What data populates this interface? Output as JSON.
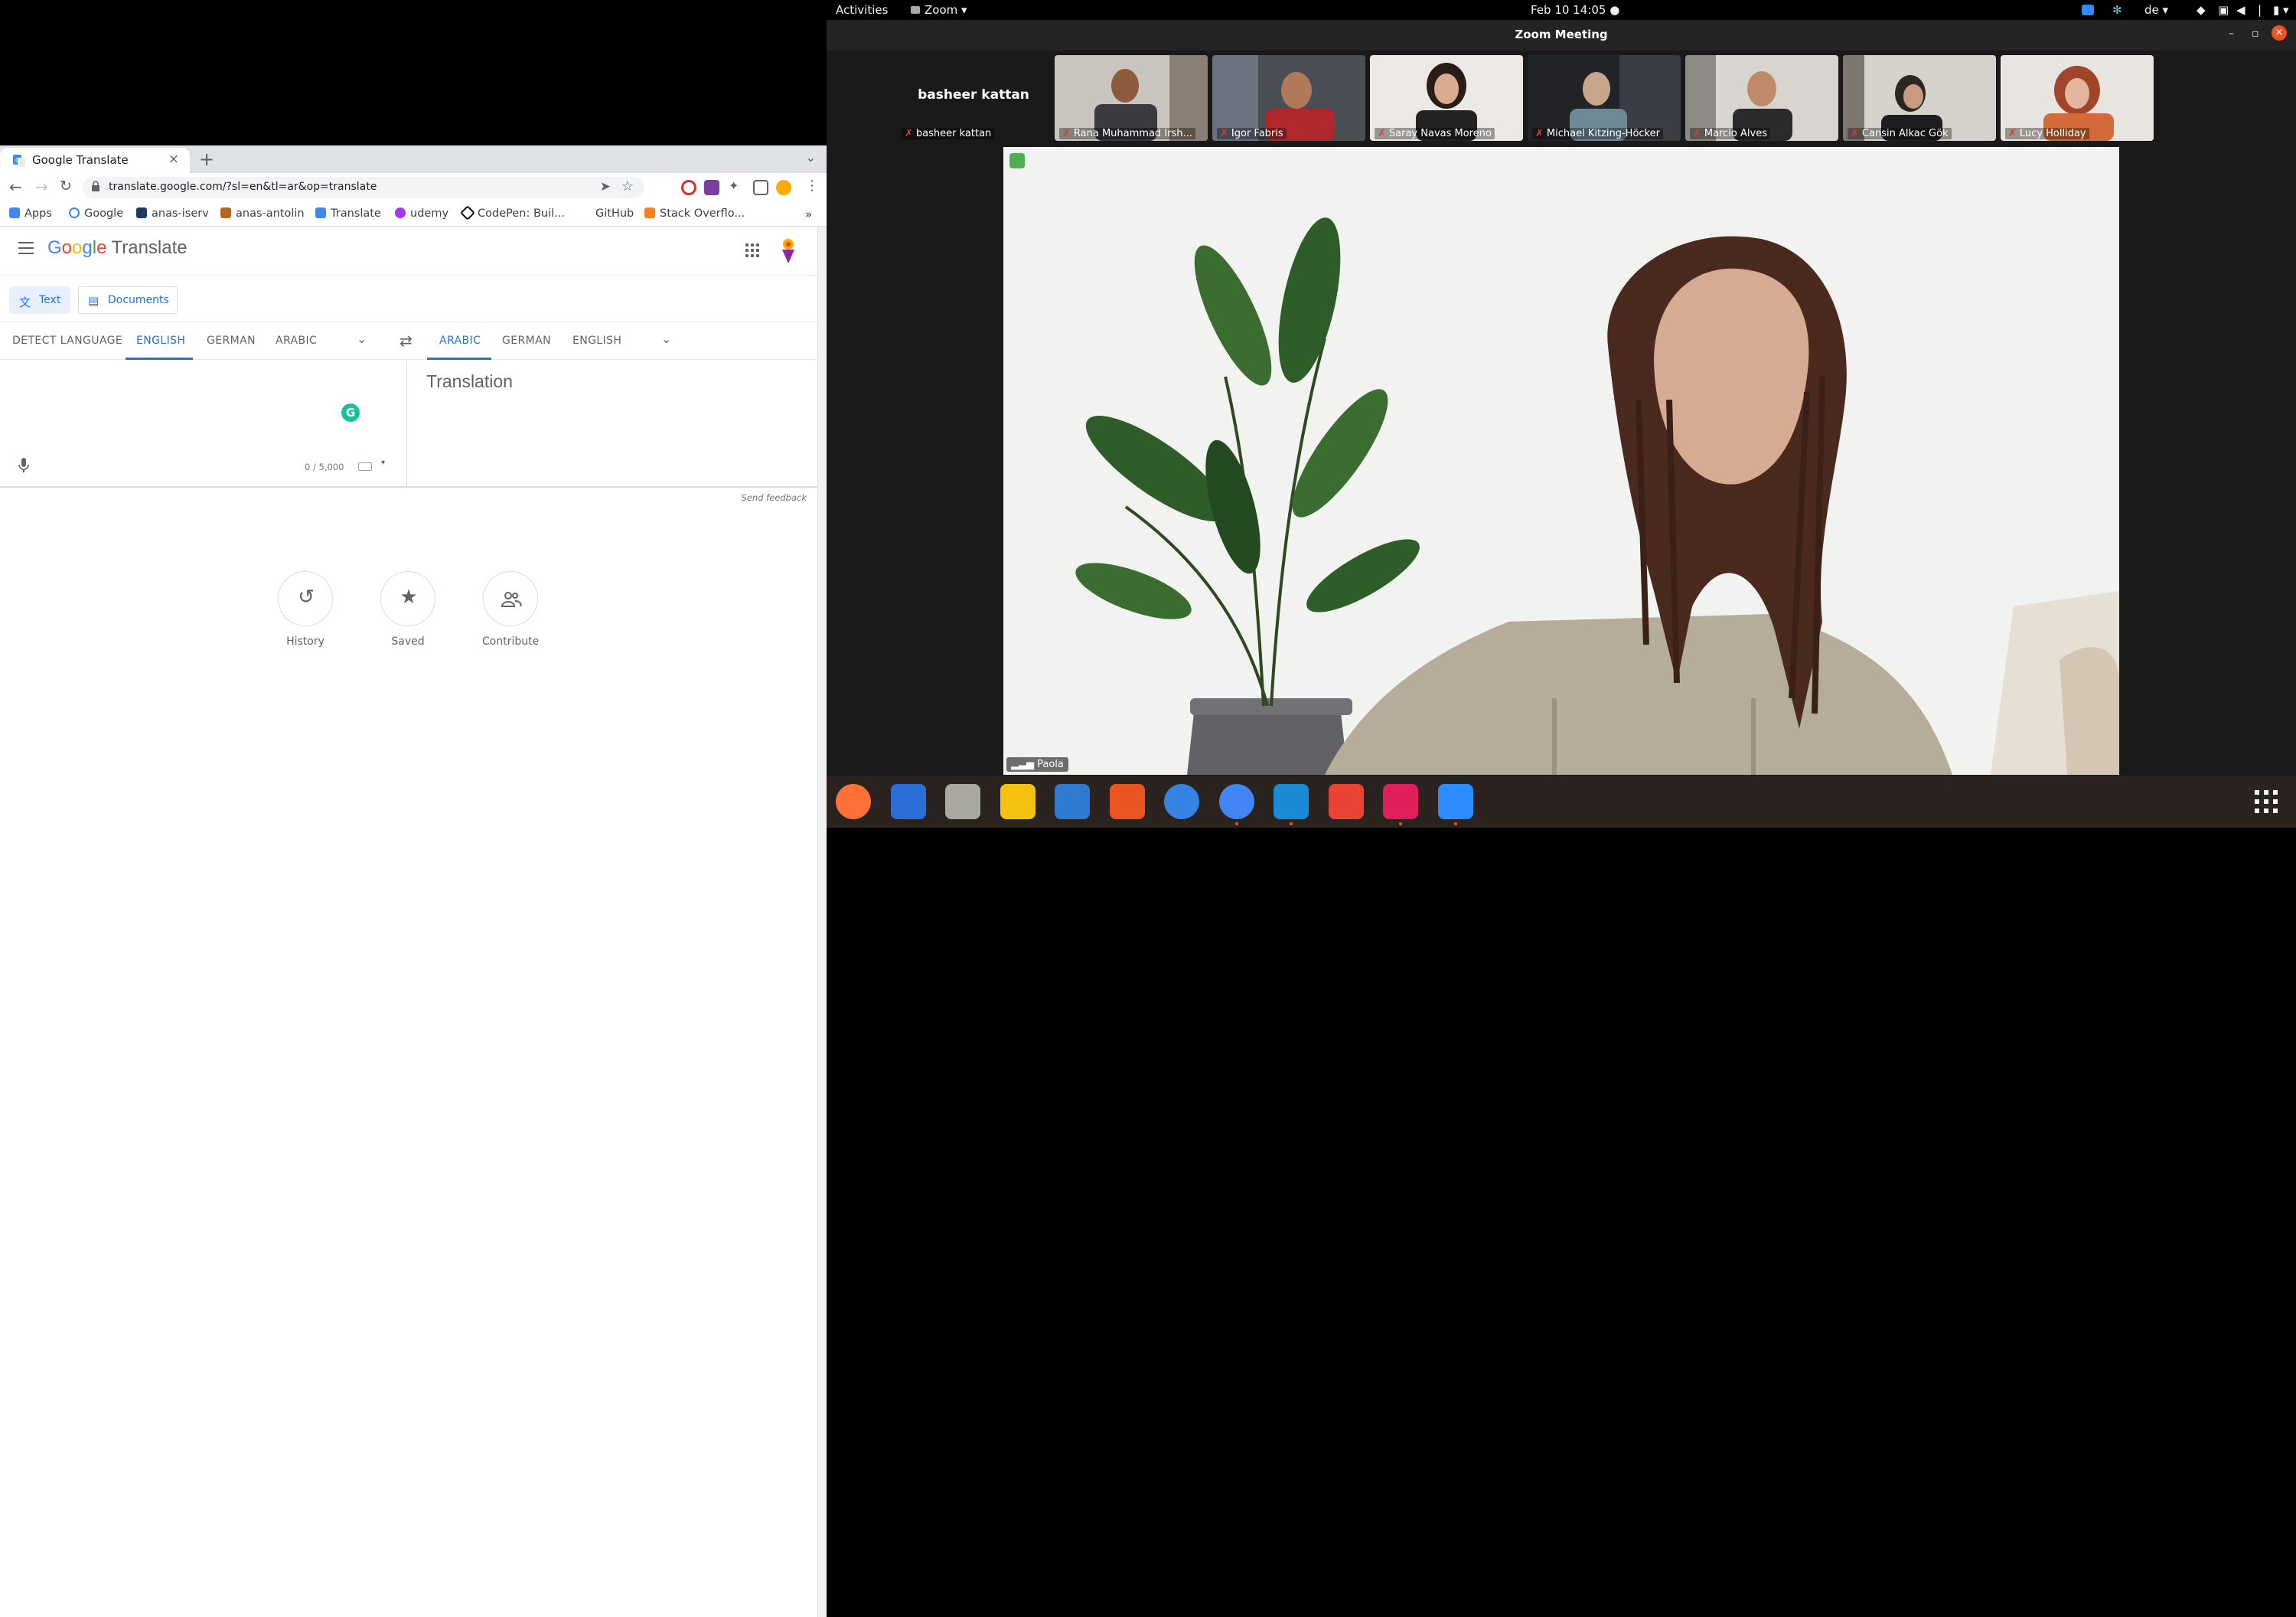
{
  "chrome": {
    "tab": {
      "title": "Google Translate",
      "close": "×"
    },
    "new_tab": "+",
    "tab_menu": "⌄",
    "url": "translate.google.com/?sl=en&tl=ar&op=translate",
    "bookmarks": [
      {
        "label": "Apps",
        "icon": "apps-grid-icon",
        "color": "#4285f4"
      },
      {
        "label": "Google",
        "icon": "google-g-icon",
        "color": "#4285f4"
      },
      {
        "label": "anas-iserv",
        "icon": "site-icon",
        "color": "#1e3a5f"
      },
      {
        "label": "anas-antolin",
        "icon": "site-icon",
        "color": "#b5651d"
      },
      {
        "label": "Translate",
        "icon": "translate-icon",
        "color": "#4285f4"
      },
      {
        "label": "udemy",
        "icon": "udemy-icon",
        "color": "#a435f0"
      },
      {
        "label": "CodePen: Buil...",
        "icon": "codepen-icon",
        "color": "#000000"
      },
      {
        "label": "GitHub",
        "icon": "github-icon",
        "color": "#ffffff"
      },
      {
        "label": "Stack Overflo...",
        "icon": "stackoverflow-icon",
        "color": "#f48024"
      }
    ],
    "bookmarks_more": "»"
  },
  "translate": {
    "logo_letters": [
      "G",
      "o",
      "o",
      "g",
      "l",
      "e"
    ],
    "logo_suffix": "Translate",
    "mode_text": "Text",
    "mode_documents": "Documents",
    "source_langs": [
      "DETECT LANGUAGE",
      "ENGLISH",
      "GERMAN",
      "ARABIC"
    ],
    "source_selected": "ENGLISH",
    "target_langs": [
      "ARABIC",
      "GERMAN",
      "ENGLISH"
    ],
    "target_selected": "ARABIC",
    "source_text": "",
    "char_count": "0 / 5,000",
    "translation_placeholder": "Translation",
    "send_feedback": "Send feedback",
    "quick_actions": [
      {
        "label": "History",
        "icon": "history-icon"
      },
      {
        "label": "Saved",
        "icon": "star-icon"
      },
      {
        "label": "Contribute",
        "icon": "contribute-icon"
      }
    ],
    "grammarly": "G"
  },
  "topbar": {
    "activities": "Activities",
    "app": "Zoom",
    "clock": "Feb 10  14:05",
    "keyboard_lang": "de"
  },
  "zoom": {
    "window_title": "Zoom Meeting",
    "participants": [
      {
        "name": "basheer kattan",
        "camera": false
      },
      {
        "name": "Rana Muhammad Irsh...",
        "camera": true
      },
      {
        "name": "Igor Fabris",
        "camera": true
      },
      {
        "name": "Saray Navas Moreno",
        "camera": true
      },
      {
        "name": "Michael Kitzing-Höcker",
        "camera": true
      },
      {
        "name": "Marcio Alves",
        "camera": true
      },
      {
        "name": "Cansin Alkac Gök",
        "camera": true
      },
      {
        "name": "Lucy Holliday",
        "camera": true
      }
    ],
    "speaker_name": "Paola"
  },
  "dock": {
    "apps": [
      {
        "name": "firefox-icon",
        "color": "#ff7139",
        "running": false
      },
      {
        "name": "thunderbird-icon",
        "color": "#2a6fd6",
        "running": false
      },
      {
        "name": "files-icon",
        "color": "#a9a9a0",
        "running": false
      },
      {
        "name": "rhythmbox-icon",
        "color": "#f5c211",
        "running": false
      },
      {
        "name": "libreoffice-writer-icon",
        "color": "#2e7ad1",
        "running": false
      },
      {
        "name": "software-center-icon",
        "color": "#e95420",
        "running": false
      },
      {
        "name": "help-icon",
        "color": "#3584e4",
        "running": false
      },
      {
        "name": "chrome-icon",
        "color": "#4285f4",
        "running": true
      },
      {
        "name": "vscode-icon",
        "color": "#1a8ad4",
        "running": true
      },
      {
        "name": "gmail-icon",
        "color": "#ea4335",
        "running": false
      },
      {
        "name": "slack-icon",
        "color": "#e01e5a",
        "running": true
      },
      {
        "name": "zoom-icon",
        "color": "#2d8cff",
        "running": true
      }
    ]
  }
}
